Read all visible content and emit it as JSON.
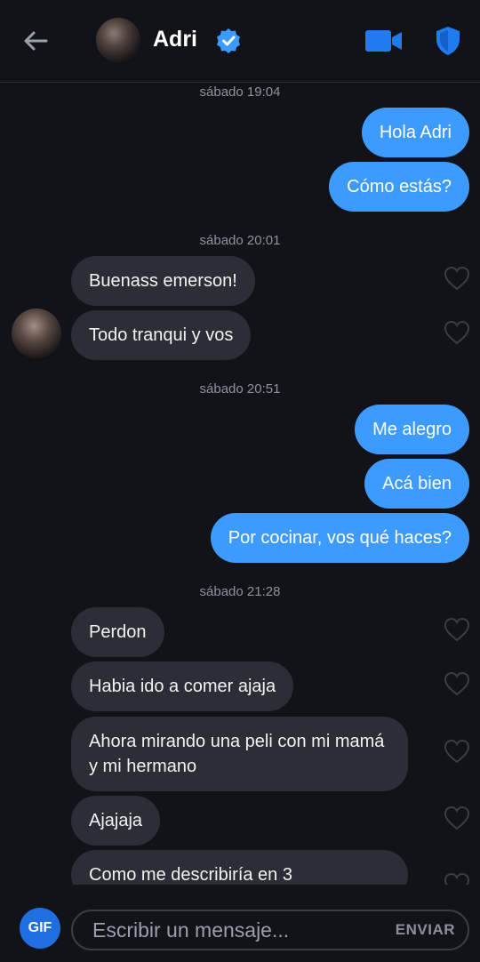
{
  "header": {
    "contact_name": "Adri",
    "icons": [
      "back-arrow-icon",
      "verified-badge-icon",
      "video-call-icon",
      "safety-shield-icon"
    ],
    "accent_color": "#3d9bff"
  },
  "messages": {
    "group1": {
      "timestamp_day": "sábado",
      "timestamp_time": "19:04",
      "m1": "Hola Adri",
      "m2": "Cómo estás?"
    },
    "group2": {
      "timestamp_day": "sábado",
      "timestamp_time": "20:01",
      "m1": "Buenass emerson!",
      "m2": "Todo tranqui y vos"
    },
    "group3": {
      "timestamp_day": "sábado",
      "timestamp_time": "20:51",
      "m1": "Me alegro",
      "m2": "Acá bien",
      "m3": "Por cocinar, vos qué haces?"
    },
    "group4": {
      "timestamp_day": "sábado",
      "timestamp_time": "21:28",
      "m1": "Perdon",
      "m2": "Habia ido a comer ajaja",
      "m3": "Ahora mirando una peli con mi mamá y mi hermano",
      "m4": "Ajajaja",
      "m5": "Como me describiría en 3"
    }
  },
  "composer": {
    "gif_label": "GIF",
    "placeholder": "Escribir un mensaje...",
    "send_label": "ENVIAR"
  }
}
